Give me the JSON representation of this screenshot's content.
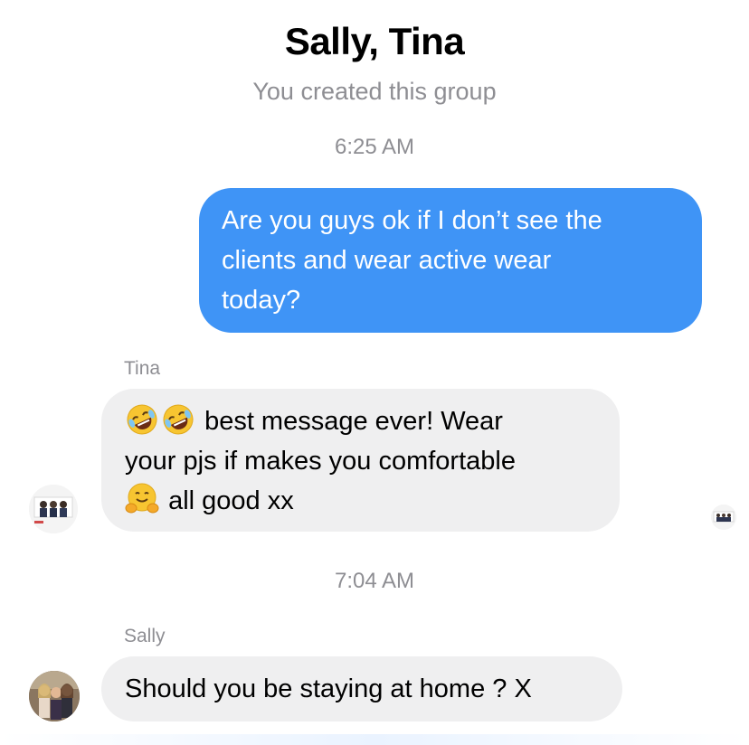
{
  "header": {
    "title": "Sally, Tina",
    "subtitle": "You created this group"
  },
  "timestamps": [
    "6:25 AM",
    "7:04 AM"
  ],
  "messages": {
    "outgoing": {
      "line1": "Are you guys ok if I don’t see the",
      "line2": "clients and wear active wear",
      "line3": "today?"
    },
    "tina": {
      "sender": "Tina",
      "line1_text": "best message ever!  Wear",
      "line2": "your pjs if makes you comfortable",
      "line3_text": "all good xx",
      "emojis": [
        "rolling-on-floor-laughing",
        "rolling-on-floor-laughing",
        "hugging-face"
      ]
    },
    "sally": {
      "sender": "Sally",
      "text": "Should you be staying at home ? X"
    }
  },
  "colors": {
    "outgoing_bubble": "#3f94f6",
    "incoming_bubble": "#efeff0",
    "meta_text": "#8e8e93"
  }
}
